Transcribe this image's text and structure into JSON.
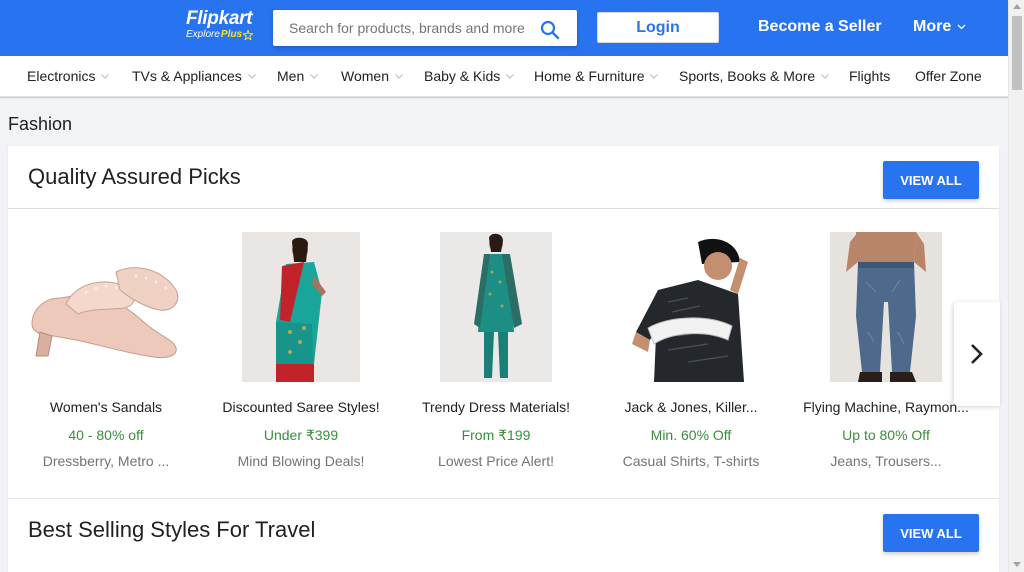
{
  "header": {
    "logo_text": "Flipkart",
    "logo_sub": "Explore",
    "logo_plus": "Plus",
    "search_placeholder": "Search for products, brands and more",
    "login_label": "Login",
    "seller_label": "Become a Seller",
    "more_label": "More",
    "brand_color": "#2874f0",
    "plus_color": "#ffe11b"
  },
  "categories": [
    {
      "label": "Electronics",
      "has_dropdown": true
    },
    {
      "label": "TVs & Appliances",
      "has_dropdown": true
    },
    {
      "label": "Men",
      "has_dropdown": true
    },
    {
      "label": "Women",
      "has_dropdown": true
    },
    {
      "label": "Baby & Kids",
      "has_dropdown": true
    },
    {
      "label": "Home & Furniture",
      "has_dropdown": true
    },
    {
      "label": "Sports, Books & More",
      "has_dropdown": true
    },
    {
      "label": "Flights",
      "has_dropdown": false
    },
    {
      "label": "Offer Zone",
      "has_dropdown": false
    }
  ],
  "page": {
    "section_label": "Fashion"
  },
  "sections": [
    {
      "title": "Quality Assured Picks",
      "view_all_label": "VIEW ALL",
      "products": [
        {
          "name": "Women's Sandals",
          "offer": "40 - 80% off",
          "sub": "Dressberry, Metro ..."
        },
        {
          "name": "Discounted Saree Styles!",
          "offer": "Under ₹399",
          "sub": "Mind Blowing Deals!"
        },
        {
          "name": "Trendy Dress Materials!",
          "offer": "From ₹199",
          "sub": "Lowest Price Alert!"
        },
        {
          "name": "Jack & Jones, Killer...",
          "offer": "Min. 60% Off",
          "sub": "Casual Shirts, T-shirts"
        },
        {
          "name": "Flying Machine, Raymon...",
          "offer": "Up to 80% Off",
          "sub": "Jeans, Trousers..."
        }
      ]
    },
    {
      "title": "Best Selling Styles For Travel",
      "view_all_label": "VIEW ALL"
    }
  ],
  "icons": {
    "search": "search-icon",
    "chevron": "chevron-down-icon",
    "next": "chevron-right-icon"
  }
}
